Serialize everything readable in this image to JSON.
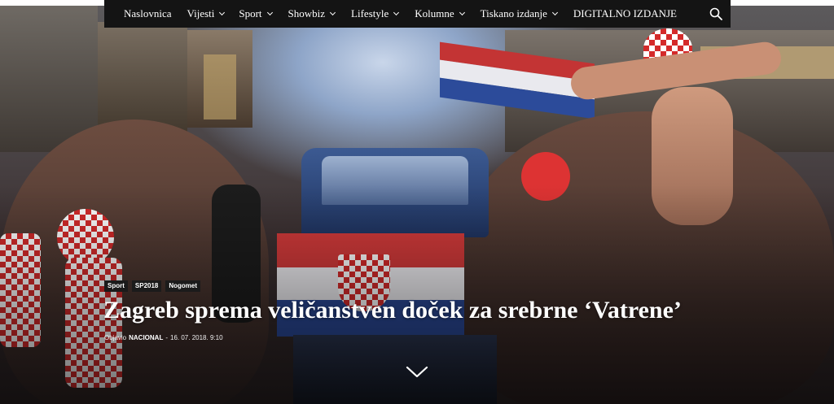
{
  "nav": {
    "items": [
      {
        "label": "Naslovnica",
        "dropdown": false
      },
      {
        "label": "Vijesti",
        "dropdown": true
      },
      {
        "label": "Sport",
        "dropdown": true
      },
      {
        "label": "Showbiz",
        "dropdown": true
      },
      {
        "label": "Lifestyle",
        "dropdown": true
      },
      {
        "label": "Kolumne",
        "dropdown": true
      },
      {
        "label": "Tiskano izdanje",
        "dropdown": true
      },
      {
        "label": "DIGITALNO IZDANJE",
        "dropdown": false
      }
    ],
    "search_icon": "search-icon"
  },
  "article": {
    "tags": [
      "Sport",
      "SP2018",
      "Nogomet"
    ],
    "title": "Zagreb sprema veličanstven doček za srebrne ‘Vatrene’",
    "byline_prefix": "Objavio",
    "author": "NACIONAL",
    "separator": "-",
    "date": "16. 07. 2018. 9:10"
  },
  "colors": {
    "navbar": "#141414",
    "croatia_red": "#d42a2a",
    "croatia_blue": "#1f3f8f",
    "text": "#ffffff"
  },
  "icons": {
    "scroll": "chevron-down-icon"
  }
}
